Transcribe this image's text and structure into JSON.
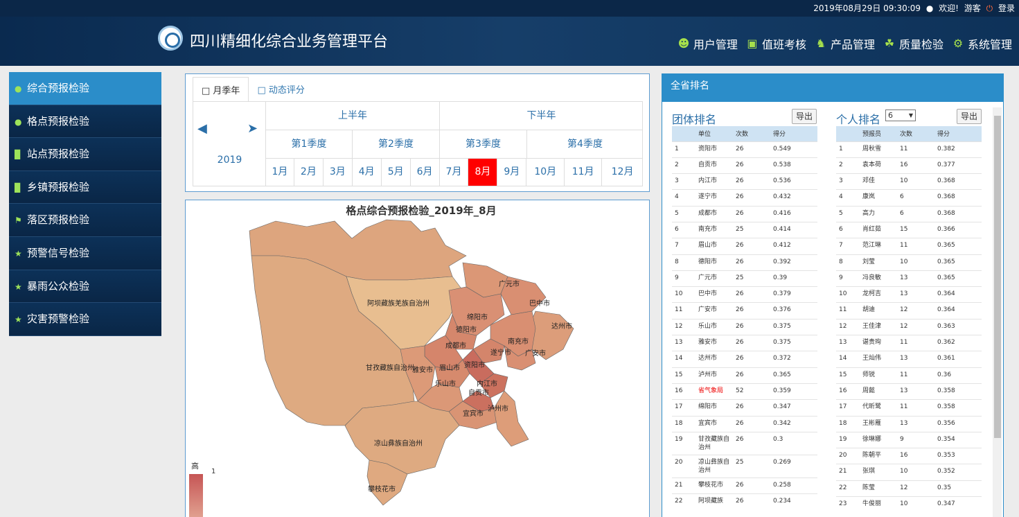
{
  "topbar": {
    "datetime": "2019年08月29日 09:30:09",
    "welcome": "欢迎!",
    "guest": "游客",
    "login": "登录"
  },
  "app": {
    "title": "四川精细化综合业务管理平台"
  },
  "nav": [
    {
      "label": "用户管理",
      "icon": "users-icon"
    },
    {
      "label": "值班考核",
      "icon": "badge-icon"
    },
    {
      "label": "产品管理",
      "icon": "trophy-icon"
    },
    {
      "label": "质量检验",
      "icon": "leaf-icon"
    },
    {
      "label": "系统管理",
      "icon": "gears-icon"
    }
  ],
  "sidebar": [
    {
      "label": "综合预报检验",
      "icon": "pin-icon"
    },
    {
      "label": "格点预报检验",
      "icon": "pin-icon"
    },
    {
      "label": "站点预报检验",
      "icon": "bar-chart-icon"
    },
    {
      "label": "乡镇预报检验",
      "icon": "bar-chart-icon"
    },
    {
      "label": "落区预报检验",
      "icon": "flag-icon"
    },
    {
      "label": "预警信号检验",
      "icon": "star-icon"
    },
    {
      "label": "暴雨公众检验",
      "icon": "star-icon"
    },
    {
      "label": "灾害预警检验",
      "icon": "star-icon"
    }
  ],
  "tabs": [
    "月季年",
    "动态评分"
  ],
  "calendar": {
    "year": "2019",
    "halves": [
      "上半年",
      "下半年"
    ],
    "quarters": [
      "第1季度",
      "第2季度",
      "第3季度",
      "第4季度"
    ],
    "months": [
      "1月",
      "2月",
      "3月",
      "4月",
      "5月",
      "6月",
      "7月",
      "8月",
      "9月",
      "10月",
      "11月",
      "12月"
    ],
    "selected_month": "8月"
  },
  "map": {
    "title": "格点综合预报检验_2019年_8月",
    "legend_high": "高",
    "legend_value": "1",
    "regions": [
      "阿坝藏族羌族自治州",
      "广元市",
      "巴中市",
      "绵阳市",
      "德阳市",
      "达州市",
      "成都市",
      "南充市",
      "遂宁市",
      "广安市",
      "甘孜藏族自治州",
      "雅安市",
      "眉山市",
      "资阳市",
      "乐山市",
      "内江市",
      "自贡市",
      "宜宾市",
      "泸州市",
      "凉山彝族自治州",
      "攀枝花市"
    ]
  },
  "ranking": {
    "title": "全省排名",
    "team_title": "团体排名",
    "person_title": "个人排名",
    "export": "导出",
    "person_count": "6",
    "team_headers": [
      "单位",
      "次数",
      "得分"
    ],
    "team_rows": [
      [
        "1",
        "资阳市",
        "26",
        "0.549"
      ],
      [
        "2",
        "自贡市",
        "26",
        "0.538"
      ],
      [
        "3",
        "内江市",
        "26",
        "0.536"
      ],
      [
        "4",
        "遂宁市",
        "26",
        "0.432"
      ],
      [
        "5",
        "成都市",
        "26",
        "0.416"
      ],
      [
        "6",
        "南充市",
        "25",
        "0.414"
      ],
      [
        "7",
        "眉山市",
        "26",
        "0.412"
      ],
      [
        "8",
        "德阳市",
        "26",
        "0.392"
      ],
      [
        "9",
        "广元市",
        "25",
        "0.39"
      ],
      [
        "10",
        "巴中市",
        "26",
        "0.379"
      ],
      [
        "11",
        "广安市",
        "26",
        "0.376"
      ],
      [
        "12",
        "乐山市",
        "26",
        "0.375"
      ],
      [
        "13",
        "雅安市",
        "26",
        "0.375"
      ],
      [
        "14",
        "达州市",
        "26",
        "0.372"
      ],
      [
        "15",
        "泸州市",
        "26",
        "0.365"
      ],
      [
        "16",
        "省气象局",
        "52",
        "0.359"
      ],
      [
        "17",
        "绵阳市",
        "26",
        "0.347"
      ],
      [
        "18",
        "宜宾市",
        "26",
        "0.342"
      ],
      [
        "19",
        "甘孜藏族自治州",
        "26",
        "0.3"
      ],
      [
        "20",
        "凉山彝族自治州",
        "25",
        "0.269"
      ],
      [
        "21",
        "攀枝花市",
        "26",
        "0.258"
      ],
      [
        "22",
        "阿坝藏族",
        "26",
        "0.234"
      ]
    ],
    "person_headers": [
      "预报员",
      "次数",
      "得分"
    ],
    "person_rows": [
      [
        "1",
        "周秋雪",
        "11",
        "0.382"
      ],
      [
        "2",
        "袁本荷",
        "16",
        "0.377"
      ],
      [
        "3",
        "邓佳",
        "10",
        "0.368"
      ],
      [
        "4",
        "康岚",
        "6",
        "0.368"
      ],
      [
        "5",
        "高力",
        "6",
        "0.368"
      ],
      [
        "6",
        "肖红茹",
        "15",
        "0.366"
      ],
      [
        "7",
        "范江琳",
        "11",
        "0.365"
      ],
      [
        "8",
        "刘莹",
        "10",
        "0.365"
      ],
      [
        "9",
        "冯良敏",
        "13",
        "0.365"
      ],
      [
        "10",
        "龙柯吉",
        "13",
        "0.364"
      ],
      [
        "11",
        "胡迪",
        "12",
        "0.364"
      ],
      [
        "12",
        "王佳津",
        "12",
        "0.363"
      ],
      [
        "13",
        "谌贵珣",
        "11",
        "0.362"
      ],
      [
        "14",
        "王灿伟",
        "13",
        "0.361"
      ],
      [
        "15",
        "师锐",
        "11",
        "0.36"
      ],
      [
        "16",
        "周懿",
        "13",
        "0.358"
      ],
      [
        "17",
        "代昕鹭",
        "11",
        "0.358"
      ],
      [
        "18",
        "王彬雁",
        "13",
        "0.356"
      ],
      [
        "19",
        "徐琳娜",
        "9",
        "0.354"
      ],
      [
        "20",
        "陈朝平",
        "16",
        "0.353"
      ],
      [
        "21",
        "张琪",
        "10",
        "0.352"
      ],
      [
        "22",
        "陈莹",
        "12",
        "0.35"
      ],
      [
        "23",
        "牛俊丽",
        "10",
        "0.347"
      ]
    ]
  }
}
